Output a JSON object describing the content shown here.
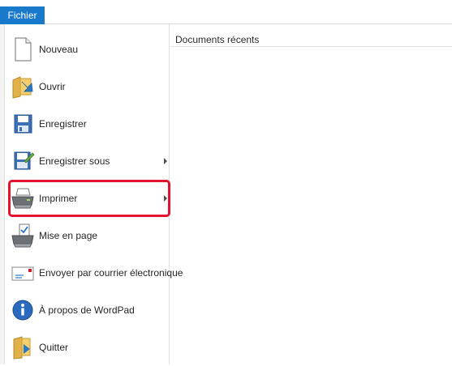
{
  "ribbon": {
    "file_tab": "Fichier"
  },
  "recent": {
    "title": "Documents récents"
  },
  "menu": {
    "items": [
      {
        "label": "Nouveau",
        "icon": "new-document-icon",
        "submenu": false
      },
      {
        "label": "Ouvrir",
        "icon": "open-folder-icon",
        "submenu": false
      },
      {
        "label": "Enregistrer",
        "icon": "save-floppy-icon",
        "submenu": false
      },
      {
        "label": "Enregistrer sous",
        "icon": "save-as-icon",
        "submenu": true
      },
      {
        "label": "Imprimer",
        "icon": "printer-icon",
        "submenu": true,
        "highlighted": true
      },
      {
        "label": "Mise en page",
        "icon": "page-setup-icon",
        "submenu": false
      },
      {
        "label": "Envoyer par courrier électronique",
        "icon": "email-envelope-icon",
        "submenu": false
      },
      {
        "label": "À propos de WordPad",
        "icon": "info-icon",
        "submenu": false
      },
      {
        "label": "Quitter",
        "icon": "exit-folder-icon",
        "submenu": false
      }
    ]
  },
  "colors": {
    "accent": "#1979ca",
    "highlight": "#e3122e"
  }
}
